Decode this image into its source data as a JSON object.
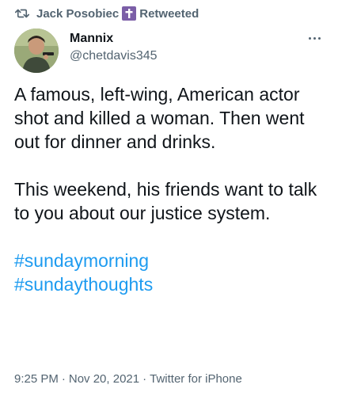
{
  "retweet": {
    "user": "Jack Posobiec",
    "label": "Retweeted",
    "icon": "retweet-icon",
    "badge_icon": "cross-icon",
    "badge_color": "#7b5ea7"
  },
  "author": {
    "name": "Mannix",
    "handle": "@chetdavis345",
    "avatar_icon": "avatar-photo"
  },
  "tweet": {
    "paragraphs": [
      "A famous, left-wing, American actor shot and killed a woman. Then went out for dinner and drinks.",
      "This weekend, his friends want to talk to you about our justice system."
    ],
    "hashtags": [
      "#sundaymorning",
      "#sundaythoughts"
    ]
  },
  "meta": {
    "time": "9:25 PM",
    "separator": "·",
    "date": "Nov 20, 2021",
    "source": "Twitter for iPhone"
  },
  "colors": {
    "link": "#1d9bf0",
    "secondary_text": "#536471",
    "primary_text": "#0f1419"
  }
}
